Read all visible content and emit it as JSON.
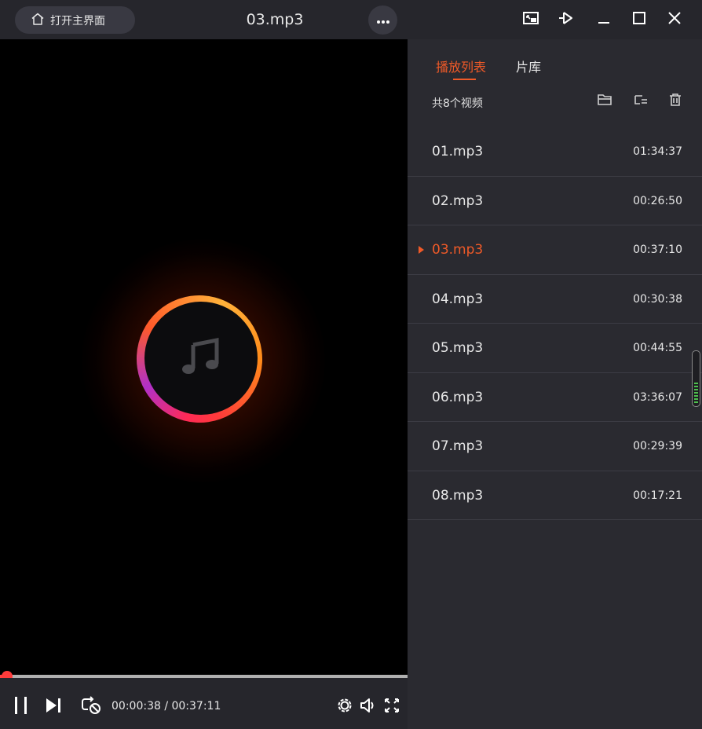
{
  "titlebar": {
    "home_label": "打开主界面",
    "title": "03.mp3",
    "icons": {
      "home": "home-icon",
      "more": "more-icon",
      "mini_mode": "mini-mode-icon",
      "pin": "pin-icon",
      "minimize": "minimize-icon",
      "maximize": "maximize-icon",
      "close": "close-icon"
    }
  },
  "player": {
    "current_time": "00:00:38",
    "total_time": "00:37:11",
    "time_display": "00:00:38 / 00:37:11",
    "progress_fraction": 0.017,
    "icons": [
      "pause-icon",
      "next-icon",
      "loop-icon",
      "settings-icon",
      "volume-icon",
      "fullscreen-icon"
    ],
    "cover_icon": "music-note-icon"
  },
  "panel": {
    "tabs": [
      {
        "label": "播放列表",
        "active": true
      },
      {
        "label": "片库",
        "active": false
      }
    ],
    "count_label": "共8个视频",
    "tool_icons": [
      "add-folder-icon",
      "playlist-settings-icon",
      "delete-icon"
    ],
    "items": [
      {
        "name": "01.mp3",
        "duration": "01:34:37",
        "playing": false
      },
      {
        "name": "02.mp3",
        "duration": "00:26:50",
        "playing": false
      },
      {
        "name": "03.mp3",
        "duration": "00:37:10",
        "playing": true
      },
      {
        "name": "04.mp3",
        "duration": "00:30:38",
        "playing": false
      },
      {
        "name": "05.mp3",
        "duration": "00:44:55",
        "playing": false
      },
      {
        "name": "06.mp3",
        "duration": "03:36:07",
        "playing": false
      },
      {
        "name": "07.mp3",
        "duration": "00:29:39",
        "playing": false
      },
      {
        "name": "08.mp3",
        "duration": "00:17:21",
        "playing": false
      }
    ]
  },
  "colors": {
    "accent": "#f05a28",
    "titlebar_bg": "#26262c",
    "panel_bg": "#2a2a30",
    "progress_played": "#ff4040",
    "progress_track": "#b0b0b0"
  }
}
